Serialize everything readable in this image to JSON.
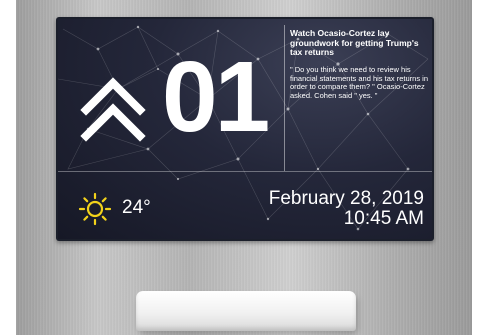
{
  "display": {
    "floor_number": "01",
    "direction": "up",
    "news": {
      "headline": "Watch Ocasio-Cortez lay groundwork for getting Trump's tax returns",
      "body": "\" Do you think we need to review his financial statements and his tax returns in order to compare them? \" Ocasio-Cortez asked. Cohen said \" yes. \""
    },
    "weather": {
      "icon": "sun-icon",
      "temperature": "24°"
    },
    "date": "February 28, 2019",
    "time": "10:45 AM"
  },
  "colors": {
    "screen_background": "#1b1f2b",
    "text": "#ffffff",
    "sun": "#f2d21b",
    "panel": "#bdbdbd"
  }
}
